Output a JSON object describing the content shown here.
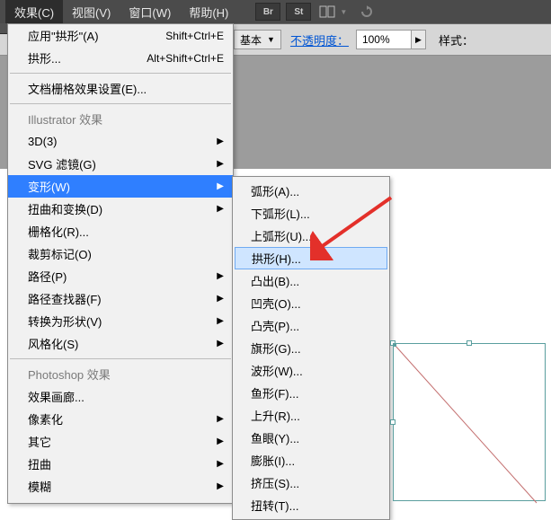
{
  "menubar": {
    "effect": "效果(C)",
    "view": "视图(V)",
    "window": "窗口(W)",
    "help": "帮助(H)",
    "iconBr": "Br",
    "iconSt": "St"
  },
  "toolbar": {
    "basic": "基本",
    "opacity_label": "不透明度：",
    "opacity_value": "100%",
    "style_label": "样式："
  },
  "menu": {
    "apply_arch": "应用\"拱形\"(A)",
    "apply_arch_sc": "Shift+Ctrl+E",
    "arch": "拱形...",
    "arch_sc": "Alt+Shift+Ctrl+E",
    "doc_raster": "文档栅格效果设置(E)...",
    "illustrator_header": "Illustrator 效果",
    "items": [
      "3D(3)",
      "SVG 滤镜(G)",
      "变形(W)",
      "扭曲和变换(D)",
      "栅格化(R)...",
      "裁剪标记(O)",
      "路径(P)",
      "路径查找器(F)",
      "转换为形状(V)",
      "风格化(S)"
    ],
    "ps_header": "Photoshop 效果",
    "ps_items": [
      "效果画廊...",
      "像素化",
      "其它",
      "扭曲",
      "模糊"
    ]
  },
  "submenu": {
    "items": [
      "弧形(A)...",
      "下弧形(L)...",
      "上弧形(U)...",
      "拱形(H)...",
      "凸出(B)...",
      "凹壳(O)...",
      "凸壳(P)...",
      "旗形(G)...",
      "波形(W)...",
      "鱼形(F)...",
      "上升(R)...",
      "鱼眼(Y)...",
      "膨胀(I)...",
      "挤压(S)...",
      "扭转(T)..."
    ],
    "highlight_index": 3
  }
}
